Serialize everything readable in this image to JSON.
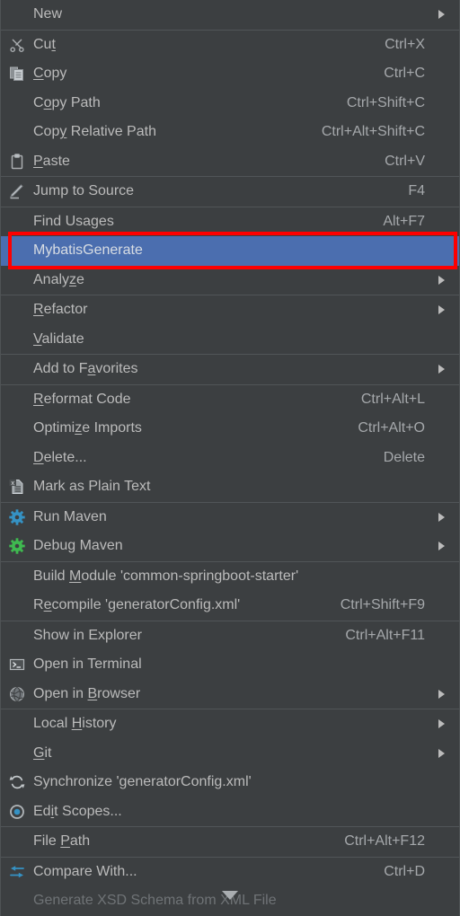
{
  "menu": {
    "theme": {
      "background": "#3c3f41",
      "text": "#bbbbbb",
      "selection_background": "#4b6eaf",
      "selection_text": "#d8dde3",
      "separator": "#515558",
      "annotation_border": "#fe0000"
    },
    "groups": [
      {
        "items": [
          {
            "label": "New",
            "mnemonic": "",
            "shortcut": "",
            "icon": "",
            "submenu": true
          }
        ]
      },
      {
        "items": [
          {
            "label": "Cut",
            "mnemonic": "t",
            "shortcut": "Ctrl+X",
            "icon": "scissors-icon",
            "submenu": false
          },
          {
            "label": "Copy",
            "mnemonic": "C",
            "shortcut": "Ctrl+C",
            "icon": "copy-icon",
            "submenu": false
          },
          {
            "label": "Copy Path",
            "mnemonic": "o",
            "shortcut": "Ctrl+Shift+C",
            "icon": "",
            "submenu": false
          },
          {
            "label": "Copy Relative Path",
            "mnemonic": "y",
            "shortcut": "Ctrl+Alt+Shift+C",
            "icon": "",
            "submenu": false
          },
          {
            "label": "Paste",
            "mnemonic": "P",
            "shortcut": "Ctrl+V",
            "icon": "clipboard-icon",
            "submenu": false
          }
        ]
      },
      {
        "items": [
          {
            "label": "Jump to Source",
            "mnemonic": "",
            "shortcut": "F4",
            "icon": "pencil-icon",
            "submenu": false
          }
        ]
      },
      {
        "items": [
          {
            "label": "Find Usages",
            "mnemonic": "",
            "shortcut": "Alt+F7",
            "icon": "",
            "submenu": false
          },
          {
            "label": "MybatisGenerate",
            "mnemonic": "",
            "shortcut": "",
            "icon": "",
            "submenu": false,
            "selected": true
          },
          {
            "label": "Analyze",
            "mnemonic": "z",
            "shortcut": "",
            "icon": "",
            "submenu": true
          }
        ]
      },
      {
        "items": [
          {
            "label": "Refactor",
            "mnemonic": "R",
            "shortcut": "",
            "icon": "",
            "submenu": true
          },
          {
            "label": "Validate",
            "mnemonic": "V",
            "shortcut": "",
            "icon": "",
            "submenu": false
          }
        ]
      },
      {
        "items": [
          {
            "label": "Add to Favorites",
            "mnemonic": "a",
            "shortcut": "",
            "icon": "",
            "submenu": true
          }
        ]
      },
      {
        "items": [
          {
            "label": "Reformat Code",
            "mnemonic": "R",
            "shortcut": "Ctrl+Alt+L",
            "icon": "",
            "submenu": false
          },
          {
            "label": "Optimize Imports",
            "mnemonic": "z",
            "shortcut": "Ctrl+Alt+O",
            "icon": "",
            "submenu": false
          },
          {
            "label": "Delete...",
            "mnemonic": "D",
            "shortcut": "Delete",
            "icon": "",
            "submenu": false
          },
          {
            "label": "Mark as Plain Text",
            "mnemonic": "",
            "shortcut": "",
            "icon": "plain-text-file-icon",
            "submenu": false
          }
        ]
      },
      {
        "items": [
          {
            "label": "Run Maven",
            "mnemonic": "",
            "shortcut": "",
            "icon": "gear-blue-icon",
            "submenu": true
          },
          {
            "label": "Debug Maven",
            "mnemonic": "",
            "shortcut": "",
            "icon": "gear-green-icon",
            "submenu": true
          }
        ]
      },
      {
        "items": [
          {
            "label": "Build Module 'common-springboot-starter'",
            "mnemonic": "M",
            "shortcut": "",
            "icon": "",
            "submenu": false
          },
          {
            "label": "Recompile 'generatorConfig.xml'",
            "mnemonic": "e",
            "shortcut": "Ctrl+Shift+F9",
            "icon": "",
            "submenu": false
          }
        ]
      },
      {
        "items": [
          {
            "label": "Show in Explorer",
            "mnemonic": "",
            "shortcut": "Ctrl+Alt+F11",
            "icon": "",
            "submenu": false
          },
          {
            "label": "Open in Terminal",
            "mnemonic": "",
            "shortcut": "",
            "icon": "terminal-icon",
            "submenu": false
          },
          {
            "label": "Open in Browser",
            "mnemonic": "B",
            "shortcut": "",
            "icon": "globe-icon",
            "submenu": true
          }
        ]
      },
      {
        "items": [
          {
            "label": "Local History",
            "mnemonic": "H",
            "shortcut": "",
            "icon": "",
            "submenu": true
          },
          {
            "label": "Git",
            "mnemonic": "G",
            "shortcut": "",
            "icon": "",
            "submenu": true
          },
          {
            "label": "Synchronize 'generatorConfig.xml'",
            "mnemonic": "",
            "shortcut": "",
            "icon": "sync-icon",
            "submenu": false
          },
          {
            "label": "Edit Scopes...",
            "mnemonic": "i",
            "shortcut": "",
            "icon": "scope-target-icon",
            "submenu": false
          }
        ]
      },
      {
        "items": [
          {
            "label": "File Path",
            "mnemonic": "P",
            "shortcut": "Ctrl+Alt+F12",
            "icon": "",
            "submenu": false
          }
        ]
      },
      {
        "items": [
          {
            "label": "Compare With...",
            "mnemonic": "",
            "shortcut": "Ctrl+D",
            "icon": "compare-icon",
            "submenu": false
          }
        ]
      }
    ],
    "clipped_item": {
      "label": "Generate XSD Schema from XML File",
      "shortcut": "",
      "icon": ""
    },
    "scroll_indicator": "scroll-down-arrow-icon"
  }
}
